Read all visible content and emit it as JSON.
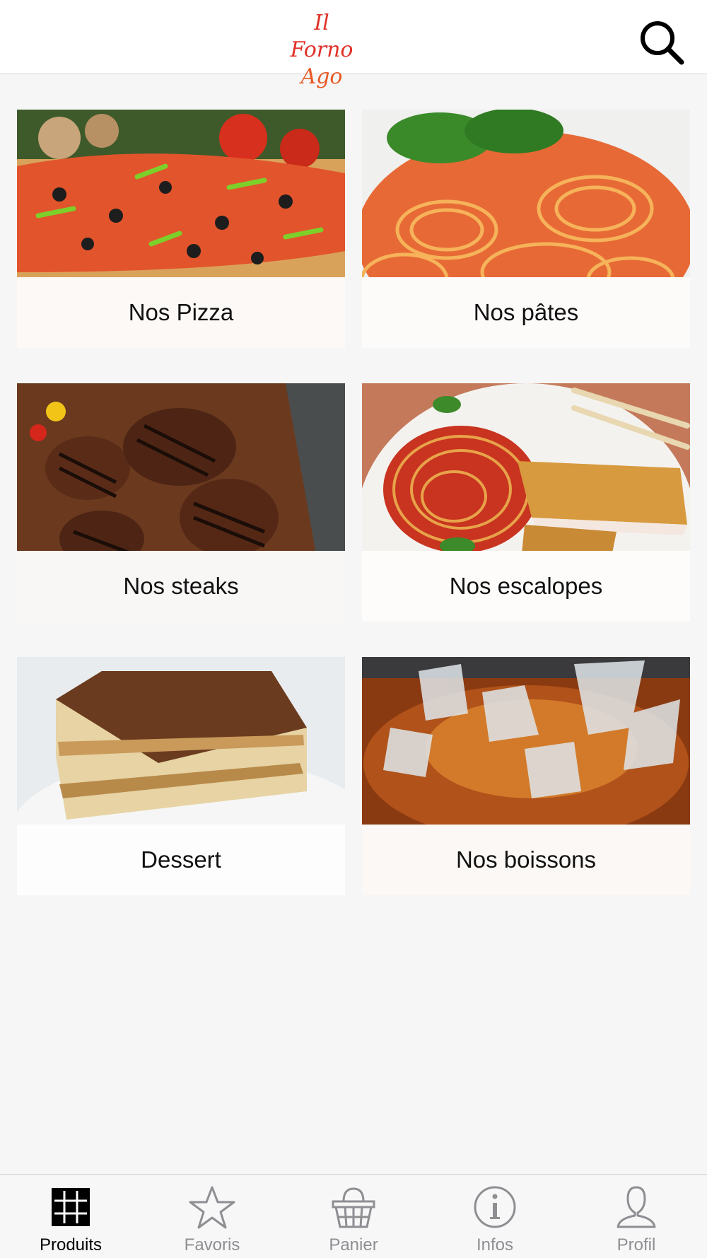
{
  "header": {
    "logo_line1": "Il Forno",
    "logo_line2": "Ago",
    "search_icon": "search-icon"
  },
  "categories": [
    {
      "label": "Nos Pizza",
      "image": "pizza-photo"
    },
    {
      "label": "Nos pâtes",
      "image": "spaghetti-photo"
    },
    {
      "label": "Nos steaks",
      "image": "steaks-photo"
    },
    {
      "label": "Nos escalopes",
      "image": "escalope-photo"
    },
    {
      "label": "Dessert",
      "image": "tiramisu-photo"
    },
    {
      "label": "Nos boissons",
      "image": "cola-photo"
    }
  ],
  "tabs": [
    {
      "label": "Produits",
      "icon": "grid-icon",
      "active": true
    },
    {
      "label": "Favoris",
      "icon": "star-icon",
      "active": false
    },
    {
      "label": "Panier",
      "icon": "basket-icon",
      "active": false
    },
    {
      "label": "Infos",
      "icon": "info-icon",
      "active": false
    },
    {
      "label": "Profil",
      "icon": "person-icon",
      "active": false
    }
  ],
  "colors": {
    "logo_red": "#e0322a",
    "active_tab": "#000000",
    "inactive_tab": "#8e8e93",
    "background": "#f6f6f7"
  }
}
